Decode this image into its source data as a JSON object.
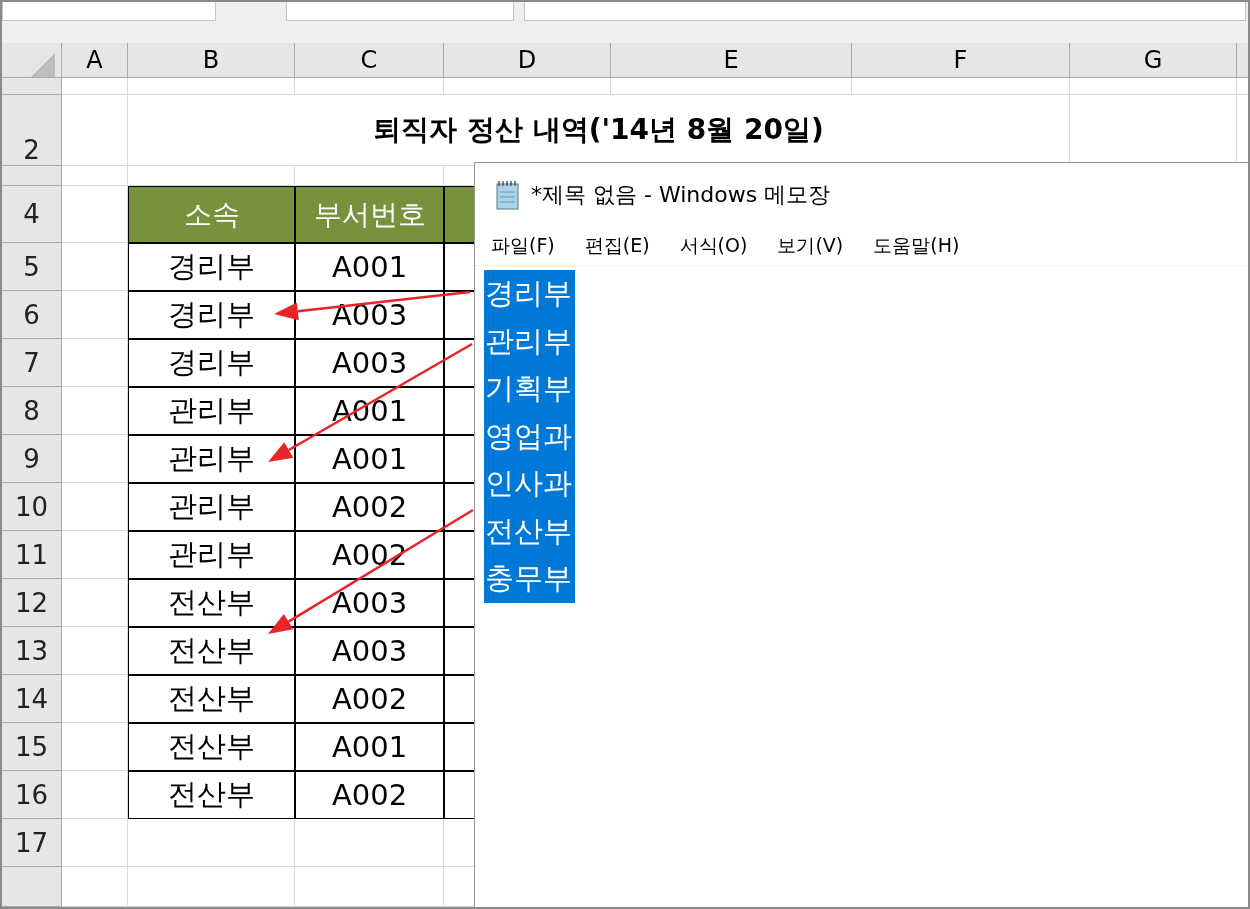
{
  "sheet": {
    "column_headers": [
      "A",
      "B",
      "C",
      "D",
      "E",
      "F",
      "G"
    ],
    "row_headers": [
      "2",
      "4",
      "5",
      "6",
      "7",
      "8",
      "9",
      "10",
      "11",
      "12",
      "13",
      "14",
      "15",
      "16",
      "17"
    ],
    "title": "퇴직자 정산 내역('14년 8월 20일)",
    "table": {
      "columns": [
        "소속",
        "부서번호"
      ],
      "rows": [
        {
          "dept": "경리부",
          "code": "A001"
        },
        {
          "dept": "경리부",
          "code": "A003"
        },
        {
          "dept": "경리부",
          "code": "A003"
        },
        {
          "dept": "관리부",
          "code": "A001"
        },
        {
          "dept": "관리부",
          "code": "A001"
        },
        {
          "dept": "관리부",
          "code": "A002"
        },
        {
          "dept": "관리부",
          "code": "A002"
        },
        {
          "dept": "전산부",
          "code": "A003"
        },
        {
          "dept": "전산부",
          "code": "A003"
        },
        {
          "dept": "전산부",
          "code": "A002"
        },
        {
          "dept": "전산부",
          "code": "A001"
        },
        {
          "dept": "전산부",
          "code": "A002"
        }
      ]
    }
  },
  "notepad": {
    "title": "*제목 없음 - Windows 메모장",
    "menu": [
      "파일(F)",
      "편집(E)",
      "서식(O)",
      "보기(V)",
      "도움말(H)"
    ],
    "lines": [
      {
        "text": "경리부",
        "selected": true
      },
      {
        "text": "관리부",
        "selected": true
      },
      {
        "text": "기획부",
        "selected": true
      },
      {
        "text": "영업과",
        "selected": true
      },
      {
        "text": "인사과",
        "selected": true
      },
      {
        "text": "전산부",
        "selected": true
      },
      {
        "text": "충무부",
        "selected": true
      }
    ]
  }
}
